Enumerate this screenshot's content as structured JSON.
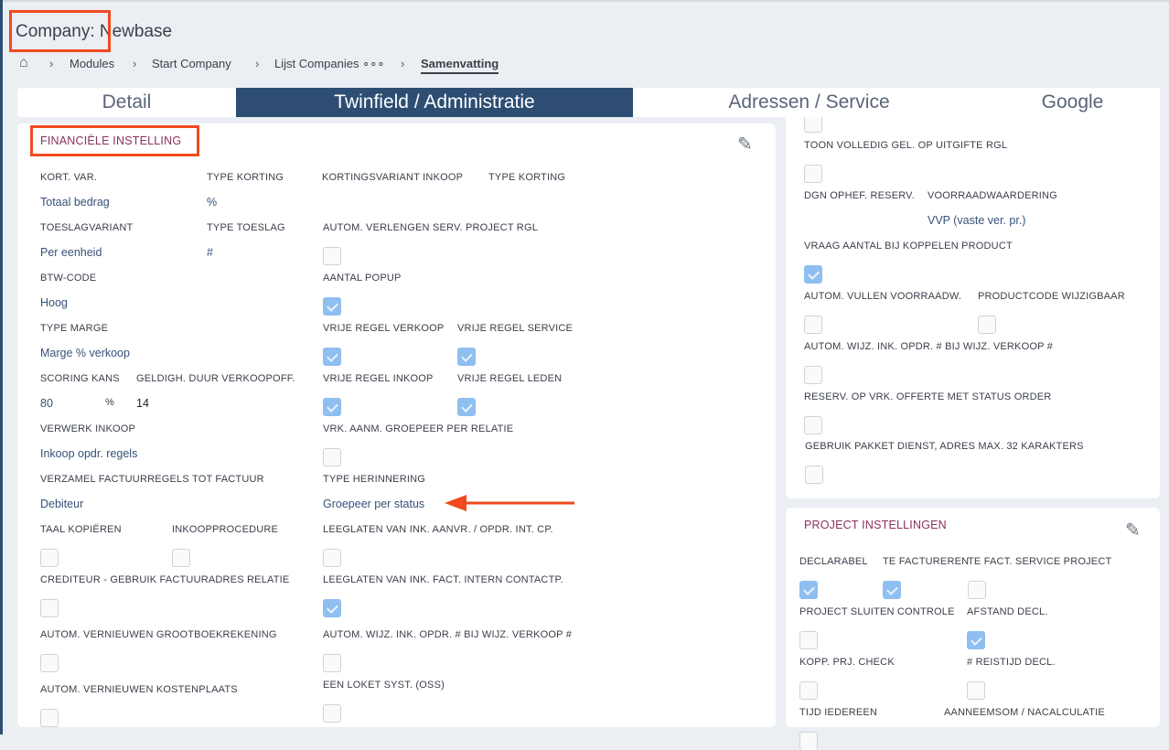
{
  "header": {
    "title": "Company: Newbase"
  },
  "breadcrumb": {
    "home_icon": "home-icon",
    "items": [
      "Modules",
      "Start Company",
      "Lijst Companies ∘∘∘"
    ],
    "active": "Samenvatting"
  },
  "tabs": [
    "Detail",
    "Twinfield / Administratie",
    "Adressen / Service",
    "Google"
  ],
  "financieel": {
    "heading": "FINANCIËLE INSTELLING",
    "fields": [
      {
        "label": "KORT. VAR.",
        "value": "Totaal bedrag"
      },
      {
        "label": "TYPE KORTING",
        "value": "%"
      },
      {
        "label": "KORTINGSVARIANT INKOOP"
      },
      {
        "label": "TYPE KORTING"
      },
      {
        "label": "TOESLAGVARIANT",
        "value": "Per eenheid"
      },
      {
        "label": "TYPE TOESLAG",
        "value": "#"
      },
      {
        "label": "AUTOM. VERLENGEN SERV. PROJECT RGL",
        "checked": false
      },
      {
        "label": "BTW-CODE",
        "value": "Hoog"
      },
      {
        "label": "AANTAL POPUP",
        "checked": true
      },
      {
        "label": "TYPE MARGE",
        "value": "Marge % verkoop"
      },
      {
        "label": "VRIJE REGEL VERKOOP",
        "checked": true
      },
      {
        "label": "VRIJE REGEL SERVICE",
        "checked": true
      },
      {
        "label": "SCORING KANS",
        "value": "80",
        "unit": "%"
      },
      {
        "label": "GELDIGH. DUUR VERKOOPOFF.",
        "value": "14"
      },
      {
        "label": "VRIJE REGEL INKOOP",
        "checked": true
      },
      {
        "label": "VRIJE REGEL LEDEN",
        "checked": true
      },
      {
        "label": "VERWERK INKOOP",
        "value": "Inkoop opdr. regels"
      },
      {
        "label": "VRK. AANM. GROEPEER PER RELATIE",
        "checked": false
      },
      {
        "label": "VERZAMEL FACTUURREGELS TOT FACTUUR",
        "value": "Debiteur"
      },
      {
        "label": "TYPE HERINNERING",
        "value": "Groepeer per status"
      },
      {
        "label": "TAAL KOPIËREN",
        "checked": false
      },
      {
        "label": "INKOOPPROCEDURE",
        "checked": false
      },
      {
        "label": "LEEGLATEN VAN INK. AANVR. / OPDR. INT. CP.",
        "checked": false
      },
      {
        "label": "CREDITEUR - GEBRUIK FACTUURADRES RELATIE",
        "checked": false
      },
      {
        "label": "LEEGLATEN VAN INK. FACT. INTERN CONTACTP.",
        "checked": true
      },
      {
        "label": "AUTOM. VERNIEUWEN GROOTBOEKREKENING",
        "checked": false
      },
      {
        "label": "AUTOM. WIJZ. INK. OPDR. # BIJ WIJZ. VERKOOP #",
        "checked": false
      },
      {
        "label": "AUTOM. VERNIEUWEN KOSTENPLAATS",
        "checked": false
      },
      {
        "label": "EEN LOKET SYST. (OSS)",
        "checked": false
      }
    ]
  },
  "voorraad": {
    "fields": [
      {
        "label": "",
        "checked": false
      },
      {
        "label": "TOON VOLLEDIG GEL. OP UITGIFTE RGL",
        "checked": false
      },
      {
        "label": "DGN OPHEF. RESERV."
      },
      {
        "label": "VOORRAADWAARDERING",
        "value": "VVP (vaste ver. pr.)"
      },
      {
        "label": "VRAAG AANTAL BIJ KOPPELEN PRODUCT",
        "checked": true
      },
      {
        "label": "AUTOM. VULLEN VOORRAADW.",
        "checked": false
      },
      {
        "label": "PRODUCTCODE WIJZIGBAAR",
        "checked": false
      },
      {
        "label": "AUTOM. WIJZ. INK. OPDR. # BIJ WIJZ. VERKOOP #",
        "checked": false
      },
      {
        "label": "RESERV. OP VRK. OFFERTE MET STATUS ORDER",
        "checked": false
      },
      {
        "label": "GEBRUIK PAKKET DIENST, ADRES MAX. 32 KARAKTERS",
        "checked": false
      }
    ]
  },
  "project": {
    "heading": "PROJECT INSTELLINGEN",
    "fields": [
      {
        "label": "DECLARABEL",
        "checked": true
      },
      {
        "label": "TE FACTUREREN",
        "checked": true
      },
      {
        "label": "TE FACT. SERVICE PROJECT",
        "checked": false
      },
      {
        "label": "PROJECT SLUITEN CONTROLE",
        "checked": false
      },
      {
        "label": "AFSTAND DECL.",
        "checked": true
      },
      {
        "label": "KOPP. PRJ. CHECK",
        "checked": false
      },
      {
        "label": "# REISTIJD DECL.",
        "checked": false
      },
      {
        "label": "TIJD IEDEREEN",
        "checked": false
      },
      {
        "label": "AANNEEMSOM / NACALCULATIE"
      }
    ]
  },
  "colors": {
    "accent": "#2d4e72",
    "heading": "#8b2f5c",
    "checked": "#8fbff0",
    "annotation": "#f04a1e"
  }
}
